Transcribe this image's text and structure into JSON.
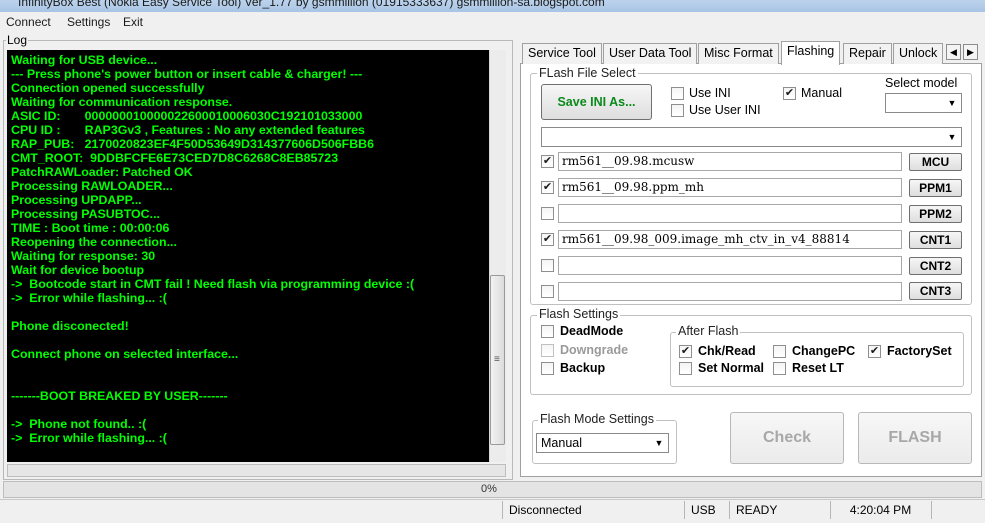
{
  "window": {
    "title": "InfinityBox Best (Nokia Easy Service Tool) Ver_1.77 by gsmmillion (01915333637) gsmmillion-sa.blogspot.com"
  },
  "menu": {
    "items": [
      "Connect",
      "Settings",
      "Exit"
    ]
  },
  "log": {
    "label": "Log",
    "lines": [
      "Waiting for USB device...",
      "--- Press phone's power button or insert cable & charger! ---",
      "Connection opened successfully",
      "Waiting for communication response.",
      "ASIC ID:       000000010000022600010006030C192101033000",
      "CPU ID :       RAP3Gv3 , Features : No any extended features",
      "RAP_PUB:   2170020823EF4F50D53649D314377606D506FBB6",
      "CMT_ROOT:  9DDBFCFE6E73CED7D8C6268C8EB85723",
      "PatchRAWLoader: Patched OK",
      "Processing RAWLOADER...",
      "Processing UPDAPP...",
      "Processing PASUBTOC...",
      "TIME : Boot time : 00:00:06",
      "Reopening the connection...",
      "Waiting for response: 30",
      "Wait for device bootup",
      "->  Bootcode start in CMT fail ! Need flash via programming device :(",
      "->  Error while flashing... :(",
      "",
      "Phone disconected!",
      "",
      "Connect phone on selected interface...",
      "",
      "",
      "-------BOOT BREAKED BY USER-------",
      "",
      "->  Phone not found.. :(",
      "->  Error while flashing... :("
    ]
  },
  "tabs": [
    "Service Tool",
    "User Data Tool",
    "Misc Format",
    "Flashing",
    "Repair",
    "Unlock"
  ],
  "active_tab": "Flashing",
  "flash_file_select": {
    "title": "FLash File Select",
    "save_ini_label": "Save INI As...",
    "use_ini_label": "Use INI",
    "use_user_ini_label": "Use User INI",
    "manual_label": "Manual",
    "select_model_label": "Select model",
    "files": [
      {
        "checked": true,
        "value": "rm561__09.98.mcusw",
        "button": "MCU"
      },
      {
        "checked": true,
        "value": "rm561__09.98.ppm_mh",
        "button": "PPM1"
      },
      {
        "checked": false,
        "value": "",
        "button": "PPM2"
      },
      {
        "checked": true,
        "value": "rm561__09.98_009.image_mh_ctv_in_v4_88814",
        "button": "CNT1"
      },
      {
        "checked": false,
        "value": "",
        "button": "CNT2"
      },
      {
        "checked": false,
        "value": "",
        "button": "CNT3"
      }
    ]
  },
  "flash_settings": {
    "title": "Flash Settings",
    "dead_mode": "DeadMode",
    "downgrade": "Downgrade",
    "backup": "Backup",
    "after_flash": {
      "title": "After Flash",
      "chk_read": "Chk/Read",
      "change_pc": "ChangePC",
      "factory_set": "FactorySet",
      "set_normal": "Set Normal",
      "reset_lt": "Reset LT"
    }
  },
  "flash_mode": {
    "title": "Flash Mode Settings",
    "selected": "Manual"
  },
  "actions": {
    "check": "Check",
    "flash": "FLASH"
  },
  "progress": {
    "text": "0%",
    "percent": 0
  },
  "status": {
    "connection": "Disconnected",
    "interface": "USB",
    "state": "READY",
    "time": "4:20:04 PM"
  },
  "glyphs": {
    "check": "✔",
    "down": "▼",
    "left": "◀",
    "right": "▶",
    "grip": "≡"
  }
}
